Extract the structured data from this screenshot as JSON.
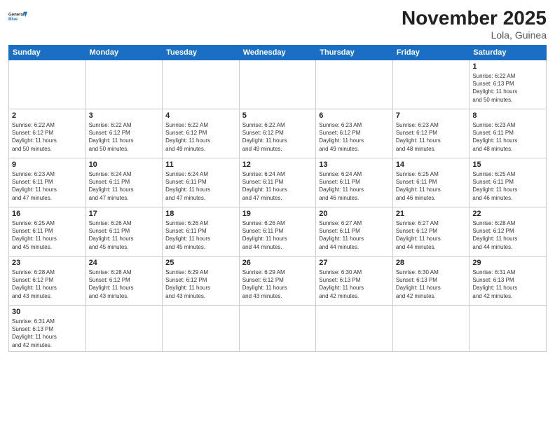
{
  "header": {
    "logo_line1": "General",
    "logo_line2": "Blue",
    "month_title": "November 2025",
    "location": "Lola, Guinea"
  },
  "days_of_week": [
    "Sunday",
    "Monday",
    "Tuesday",
    "Wednesday",
    "Thursday",
    "Friday",
    "Saturday"
  ],
  "weeks": [
    [
      {
        "day": "",
        "info": ""
      },
      {
        "day": "",
        "info": ""
      },
      {
        "day": "",
        "info": ""
      },
      {
        "day": "",
        "info": ""
      },
      {
        "day": "",
        "info": ""
      },
      {
        "day": "",
        "info": ""
      },
      {
        "day": "1",
        "info": "Sunrise: 6:22 AM\nSunset: 6:13 PM\nDaylight: 11 hours\nand 50 minutes."
      }
    ],
    [
      {
        "day": "2",
        "info": "Sunrise: 6:22 AM\nSunset: 6:12 PM\nDaylight: 11 hours\nand 50 minutes."
      },
      {
        "day": "3",
        "info": "Sunrise: 6:22 AM\nSunset: 6:12 PM\nDaylight: 11 hours\nand 50 minutes."
      },
      {
        "day": "4",
        "info": "Sunrise: 6:22 AM\nSunset: 6:12 PM\nDaylight: 11 hours\nand 49 minutes."
      },
      {
        "day": "5",
        "info": "Sunrise: 6:22 AM\nSunset: 6:12 PM\nDaylight: 11 hours\nand 49 minutes."
      },
      {
        "day": "6",
        "info": "Sunrise: 6:23 AM\nSunset: 6:12 PM\nDaylight: 11 hours\nand 49 minutes."
      },
      {
        "day": "7",
        "info": "Sunrise: 6:23 AM\nSunset: 6:12 PM\nDaylight: 11 hours\nand 48 minutes."
      },
      {
        "day": "8",
        "info": "Sunrise: 6:23 AM\nSunset: 6:11 PM\nDaylight: 11 hours\nand 48 minutes."
      }
    ],
    [
      {
        "day": "9",
        "info": "Sunrise: 6:23 AM\nSunset: 6:11 PM\nDaylight: 11 hours\nand 47 minutes."
      },
      {
        "day": "10",
        "info": "Sunrise: 6:24 AM\nSunset: 6:11 PM\nDaylight: 11 hours\nand 47 minutes."
      },
      {
        "day": "11",
        "info": "Sunrise: 6:24 AM\nSunset: 6:11 PM\nDaylight: 11 hours\nand 47 minutes."
      },
      {
        "day": "12",
        "info": "Sunrise: 6:24 AM\nSunset: 6:11 PM\nDaylight: 11 hours\nand 47 minutes."
      },
      {
        "day": "13",
        "info": "Sunrise: 6:24 AM\nSunset: 6:11 PM\nDaylight: 11 hours\nand 46 minutes."
      },
      {
        "day": "14",
        "info": "Sunrise: 6:25 AM\nSunset: 6:11 PM\nDaylight: 11 hours\nand 46 minutes."
      },
      {
        "day": "15",
        "info": "Sunrise: 6:25 AM\nSunset: 6:11 PM\nDaylight: 11 hours\nand 46 minutes."
      }
    ],
    [
      {
        "day": "16",
        "info": "Sunrise: 6:25 AM\nSunset: 6:11 PM\nDaylight: 11 hours\nand 45 minutes."
      },
      {
        "day": "17",
        "info": "Sunrise: 6:26 AM\nSunset: 6:11 PM\nDaylight: 11 hours\nand 45 minutes."
      },
      {
        "day": "18",
        "info": "Sunrise: 6:26 AM\nSunset: 6:11 PM\nDaylight: 11 hours\nand 45 minutes."
      },
      {
        "day": "19",
        "info": "Sunrise: 6:26 AM\nSunset: 6:11 PM\nDaylight: 11 hours\nand 44 minutes."
      },
      {
        "day": "20",
        "info": "Sunrise: 6:27 AM\nSunset: 6:11 PM\nDaylight: 11 hours\nand 44 minutes."
      },
      {
        "day": "21",
        "info": "Sunrise: 6:27 AM\nSunset: 6:12 PM\nDaylight: 11 hours\nand 44 minutes."
      },
      {
        "day": "22",
        "info": "Sunrise: 6:28 AM\nSunset: 6:12 PM\nDaylight: 11 hours\nand 44 minutes."
      }
    ],
    [
      {
        "day": "23",
        "info": "Sunrise: 6:28 AM\nSunset: 6:12 PM\nDaylight: 11 hours\nand 43 minutes."
      },
      {
        "day": "24",
        "info": "Sunrise: 6:28 AM\nSunset: 6:12 PM\nDaylight: 11 hours\nand 43 minutes."
      },
      {
        "day": "25",
        "info": "Sunrise: 6:29 AM\nSunset: 6:12 PM\nDaylight: 11 hours\nand 43 minutes."
      },
      {
        "day": "26",
        "info": "Sunrise: 6:29 AM\nSunset: 6:12 PM\nDaylight: 11 hours\nand 43 minutes."
      },
      {
        "day": "27",
        "info": "Sunrise: 6:30 AM\nSunset: 6:13 PM\nDaylight: 11 hours\nand 42 minutes."
      },
      {
        "day": "28",
        "info": "Sunrise: 6:30 AM\nSunset: 6:13 PM\nDaylight: 11 hours\nand 42 minutes."
      },
      {
        "day": "29",
        "info": "Sunrise: 6:31 AM\nSunset: 6:13 PM\nDaylight: 11 hours\nand 42 minutes."
      }
    ],
    [
      {
        "day": "30",
        "info": "Sunrise: 6:31 AM\nSunset: 6:13 PM\nDaylight: 11 hours\nand 42 minutes."
      },
      {
        "day": "",
        "info": ""
      },
      {
        "day": "",
        "info": ""
      },
      {
        "day": "",
        "info": ""
      },
      {
        "day": "",
        "info": ""
      },
      {
        "day": "",
        "info": ""
      },
      {
        "day": "",
        "info": ""
      }
    ]
  ]
}
